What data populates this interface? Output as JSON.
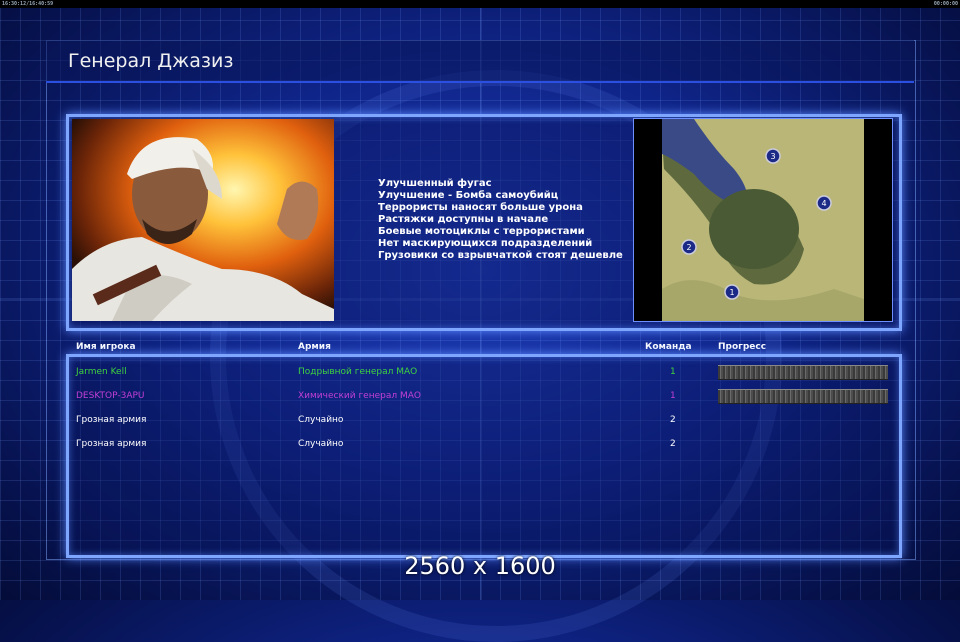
{
  "statusbar": {
    "left": "16:30:12/16:40:59",
    "right": "00:00:00"
  },
  "title": "Генерал Джазиз",
  "portrait": {
    "alt_icon": "general-portrait"
  },
  "bonuses": [
    "Улучшенный фугас",
    "Улучшение - Бомба самоубийц",
    "Террористы наносят больше урона",
    "Растяжки доступны в начале",
    "Боевые мотоциклы с террористами",
    "Нет маскирующихся подразделений",
    "Грузовики со взрывчаткой стоят дешевле"
  ],
  "map": {
    "start_positions": [
      "1",
      "2",
      "3",
      "4"
    ]
  },
  "table": {
    "headers": {
      "player": "Имя игрока",
      "army": "Армия",
      "team": "Команда",
      "progress": "Прогресс"
    },
    "rows": [
      {
        "player": "Jarmen Kell",
        "army": "Подрывной генерал МАО",
        "team": "1",
        "color": "#3fd23f",
        "progress": 1.0
      },
      {
        "player": "DESKTOP-3APU",
        "army": "Химический генерал МАО",
        "team": "1",
        "color": "#c23fd6",
        "progress": 1.0
      },
      {
        "player": "Грозная армия",
        "army": "Случайно",
        "team": "2",
        "color": "#ffffff"
      },
      {
        "player": "Грозная армия",
        "army": "Случайно",
        "team": "2",
        "color": "#ffffff"
      }
    ]
  },
  "watermark": "2560 x 1600"
}
